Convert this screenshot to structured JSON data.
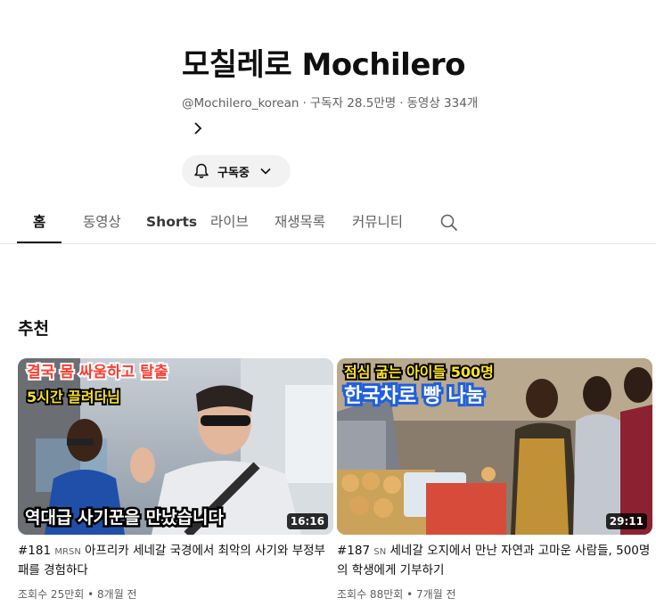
{
  "channel": {
    "name": "모칠레로 Mochilero",
    "handle": "@Mochilero_korean",
    "subscribers": "구독자 28.5만명",
    "videos": "동영상 334개",
    "separator": "·",
    "subscribe_label": "구독중"
  },
  "tabs": [
    {
      "label": "홈"
    },
    {
      "label": "동영상"
    },
    {
      "label": "Shorts"
    },
    {
      "label": "라이브"
    },
    {
      "label": "재생목록"
    },
    {
      "label": "커뮤니티"
    }
  ],
  "section": {
    "title": "추천"
  },
  "videos": [
    {
      "caption_top": "결국 몸 싸움하고 탈출",
      "caption_mid": "5시간 끌려다님",
      "caption_bottom": "역대급 사기꾼을 만났습니다",
      "duration": "16:16",
      "number": "#181",
      "tag": "MRSN",
      "title": "아프리카 세네갈 국경에서 최악의 사기와 부정부패를 경험하다",
      "views": "조회수 25만회",
      "age": "8개월 전"
    },
    {
      "caption_top": "점심 굶는 아이들 500명",
      "caption_mid": "한국차로 빵 나눔",
      "duration": "29:11",
      "number": "#187",
      "tag": "SN",
      "title": "세네갈 오지에서 만난 자연과 고마운 사람들, 500명의 학생에게 기부하기",
      "views": "조회수 88만회",
      "age": "7개월 전"
    }
  ],
  "icons": {
    "more": "chevron-right-icon",
    "bell": "bell-icon",
    "dropdown": "chevron-down-icon",
    "search": "search-icon"
  }
}
